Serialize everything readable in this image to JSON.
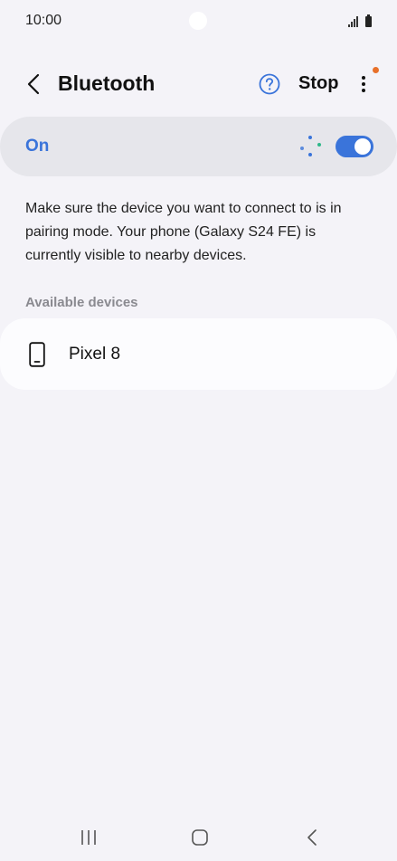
{
  "status_bar": {
    "time": "10:00",
    "icons": [
      "signal-icon",
      "battery-icon"
    ]
  },
  "app_bar": {
    "title": "Bluetooth",
    "stop_label": "Stop",
    "icons": [
      "back-arrow-icon",
      "help-icon",
      "more-vert-icon"
    ]
  },
  "bluetooth_switch": {
    "label": "On",
    "state": "on",
    "accent_color": "#3a74da"
  },
  "description": "Make sure the device you want to connect to is in pairing mode. Your phone (Galaxy S24 FE) is currently visible to nearby devices.",
  "available_devices": {
    "header": "Available devices",
    "items": [
      {
        "name": "Pixel 8",
        "icon": "phone-icon"
      }
    ]
  },
  "nav_bar": {
    "icons": [
      "recents-icon",
      "home-icon",
      "back-icon"
    ]
  },
  "colors": {
    "background": "#f4f3f8",
    "notification_dot": "#e8702a"
  }
}
